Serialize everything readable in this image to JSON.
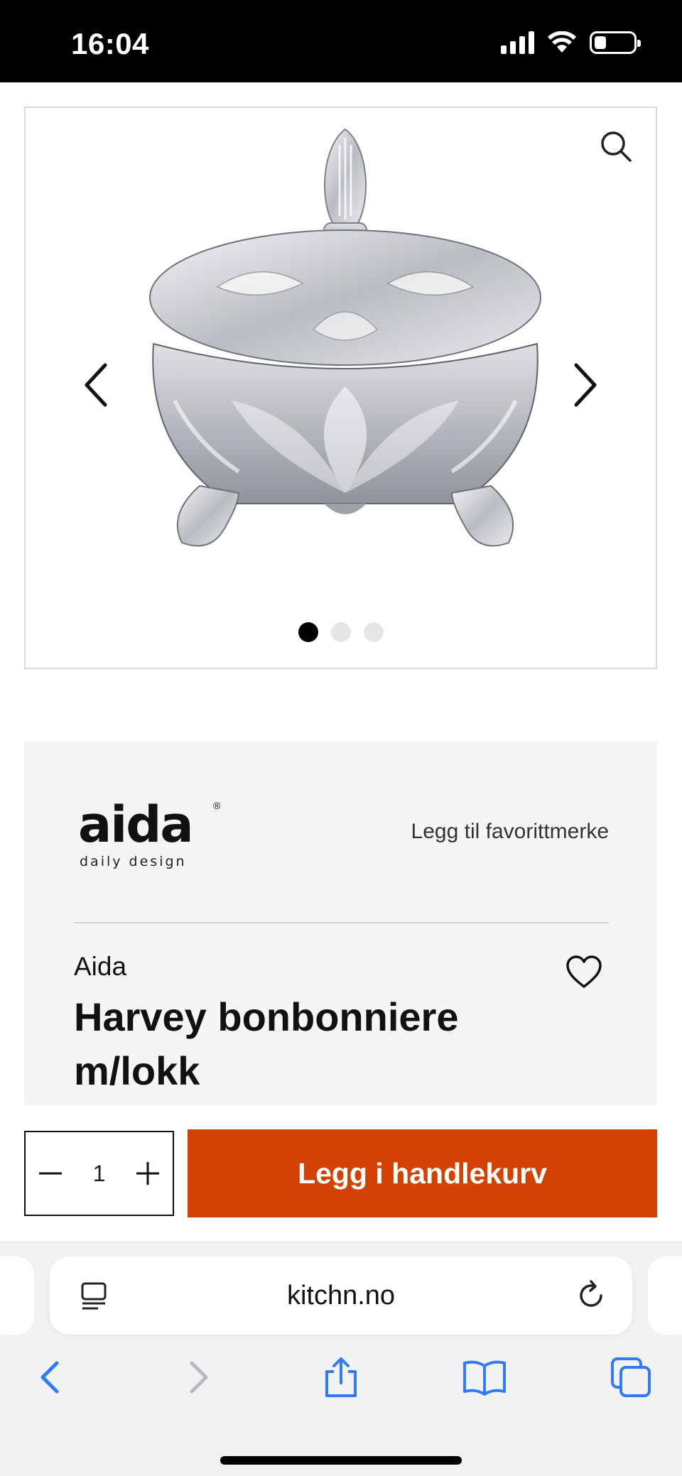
{
  "status_bar": {
    "time": "16:04",
    "icons": [
      "signal-icon",
      "wifi-icon",
      "battery-icon"
    ],
    "battery_level": 0.3
  },
  "gallery": {
    "image_name": "glass-bonbonniere-with-lid",
    "slide_count": 3,
    "active_slide": 1,
    "icons": [
      "zoom-icon",
      "chevron-left-icon",
      "chevron-right-icon"
    ]
  },
  "product": {
    "logo_word": "aida",
    "logo_tagline": "daily design",
    "logo_mark": "®",
    "favorite_brand_label": "Legg til favorittmerke",
    "brand": "Aida",
    "title": "Harvey bonbonniere m/lokk"
  },
  "purchase": {
    "quantity": "1",
    "add_to_cart_label": "Legg i handlekurv",
    "button_color": "#d34103"
  },
  "browser": {
    "url": "kitchn.no",
    "accent_color": "#2f7cf6",
    "icons": [
      "reader-icon",
      "reload-icon",
      "back-icon",
      "forward-icon",
      "share-icon",
      "bookmarks-icon",
      "tabs-icon"
    ]
  }
}
